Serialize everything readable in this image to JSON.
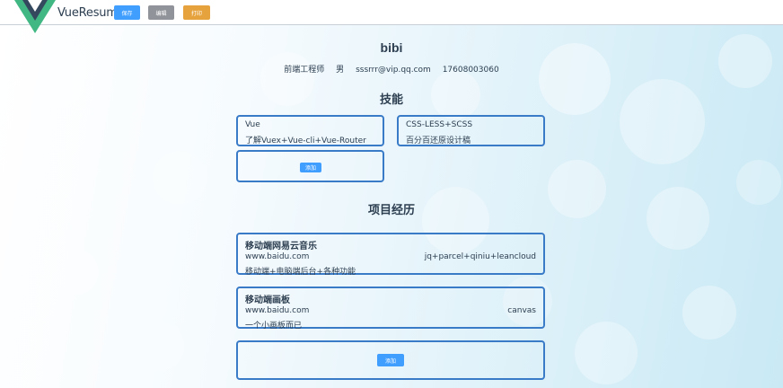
{
  "header": {
    "brand": "VueResume",
    "save_label": "保存",
    "edit_label": "编辑",
    "print_label": "打印"
  },
  "profile": {
    "name": "bibi",
    "job": "前端工程师",
    "gender": "男",
    "email": "sssrrr@vip.qq.com",
    "phone": "17608003060"
  },
  "skills": {
    "title": "技能",
    "items": [
      {
        "name": "Vue",
        "desc": "了解Vuex+Vue-cli+Vue-Router"
      },
      {
        "name": "CSS-LESS+SCSS",
        "desc": "百分百还原设计稿"
      }
    ],
    "add_label": "添加"
  },
  "projects": {
    "title": "项目经历",
    "items": [
      {
        "name": "移动端网易云音乐",
        "url": "www.baidu.com",
        "tech": "jq+parcel+qiniu+leancloud",
        "desc": "移动端+电脑端后台+各种功能"
      },
      {
        "name": "移动端画板",
        "url": "www.baidu.com",
        "tech": "canvas",
        "desc": "一个小画板而已"
      }
    ],
    "add_label": "添加"
  },
  "colors": {
    "primary": "#409eff",
    "info": "#909399",
    "warning": "#e6a23c",
    "card_border": "#3a7bc8",
    "logo_green": "#41b883",
    "logo_dark": "#35495e"
  }
}
